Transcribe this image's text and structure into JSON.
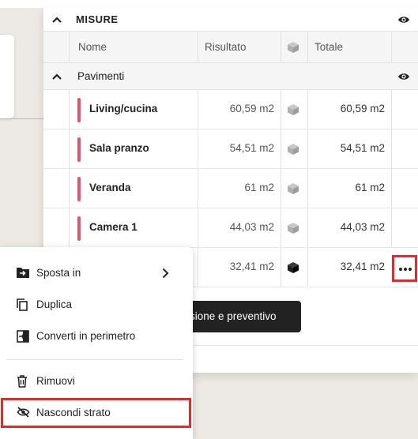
{
  "panel": {
    "section_title": "MISURE",
    "columns": [
      "Nome",
      "Risultato",
      "Totale"
    ],
    "group_name": "Pavimenti",
    "rows": [
      {
        "name": "Living/cucina",
        "result": "60,59 m2",
        "total": "60,59 m2",
        "color": "#e2546e"
      },
      {
        "name": "Sala pranzo",
        "result": "54,51 m2",
        "total": "54,51 m2",
        "color": "#e2546e"
      },
      {
        "name": "Veranda",
        "result": "61 m2",
        "total": "61 m2",
        "color": "#e2546e"
      },
      {
        "name": "Camera 1",
        "result": "44,03 m2",
        "total": "44,03 m2",
        "color": "#e2546e"
      },
      {
        "name": "",
        "result": "32,41 m2",
        "total": "32,41 m2",
        "color": "#e2546e"
      }
    ],
    "action_button": "isione e preventivo"
  },
  "context_menu": {
    "items": [
      {
        "label": "Sposta in",
        "icon": "folder-move-icon"
      },
      {
        "label": "Duplica",
        "icon": "copy-icon"
      },
      {
        "label": "Converti in perimetro",
        "icon": "convert-icon"
      },
      {
        "label": "Rimuovi",
        "icon": "trash-icon"
      },
      {
        "label": "Nascondi strato",
        "icon": "eye-off-icon"
      }
    ]
  },
  "colors": {
    "accent_highlight": "#e32b2b",
    "layer_color": "#e2546e",
    "dark_button": "#222222"
  }
}
